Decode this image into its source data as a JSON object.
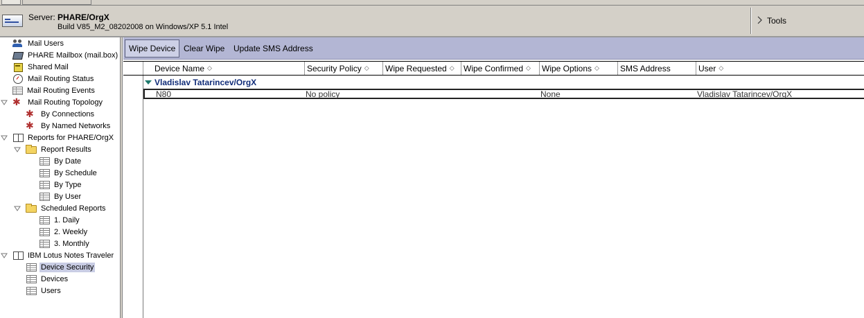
{
  "server": {
    "label": "Server:",
    "name": "PHARE/OrgX",
    "build": "Build V85_M2_08202008 on Windows/XP 5.1 Intel"
  },
  "tools": {
    "label": "Tools"
  },
  "nav": {
    "items": [
      {
        "label": "Mail Users",
        "icon": "users-icon"
      },
      {
        "label": "PHARE Mailbox (mail.box)",
        "icon": "mailbox-icon"
      },
      {
        "label": "Shared Mail",
        "icon": "shared-mail-icon"
      },
      {
        "label": "Mail Routing Status",
        "icon": "gauge-icon"
      },
      {
        "label": "Mail Routing Events",
        "icon": "table-icon"
      },
      {
        "label": "Mail Routing Topology",
        "icon": "topology-icon"
      },
      {
        "label": "By Connections",
        "icon": "topology-icon"
      },
      {
        "label": "By Named Networks",
        "icon": "topology-icon"
      },
      {
        "label": "Reports for PHARE/OrgX",
        "icon": "book-icon"
      },
      {
        "label": "Report Results",
        "icon": "folder-icon"
      },
      {
        "label": "By Date",
        "icon": "table-icon"
      },
      {
        "label": "By Schedule",
        "icon": "table-icon"
      },
      {
        "label": "By Type",
        "icon": "table-icon"
      },
      {
        "label": "By User",
        "icon": "table-icon"
      },
      {
        "label": "Scheduled Reports",
        "icon": "folder-icon"
      },
      {
        "label": "1. Daily",
        "icon": "table-icon"
      },
      {
        "label": "2. Weekly",
        "icon": "table-icon"
      },
      {
        "label": "3. Monthly",
        "icon": "table-icon"
      },
      {
        "label": "IBM Lotus Notes Traveler",
        "icon": "book-icon"
      },
      {
        "label": "Device Security",
        "icon": "table-icon"
      },
      {
        "label": "Devices",
        "icon": "table-icon"
      },
      {
        "label": "Users",
        "icon": "table-icon"
      }
    ],
    "selected": "Device Security"
  },
  "toolbar": {
    "wipe_device": "Wipe Device",
    "clear_wipe": "Clear Wipe",
    "update_sms": "Update SMS Address"
  },
  "view": {
    "columns": [
      "Device Name",
      "Security Policy",
      "Wipe Requested",
      "Wipe Confirmed",
      "Wipe Options",
      "SMS Address",
      "User"
    ],
    "sort_glyph": "◇",
    "group": "Vladislav Tatarincev/OrgX",
    "rows": [
      {
        "device_name": "N80",
        "security_policy": "No policy",
        "wipe_requested": "",
        "wipe_confirmed": "",
        "wipe_options": "None",
        "sms_address": "",
        "user": "Vladislav Tatarincev/OrgX"
      }
    ]
  },
  "colors": {
    "chrome": "#d4d0c8",
    "toolbar": "#b3b6d4",
    "selection": "#c9cde4",
    "group_text": "#102c78"
  }
}
